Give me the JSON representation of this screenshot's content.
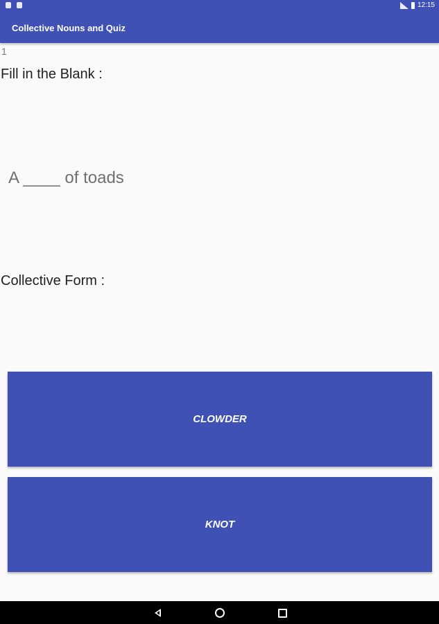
{
  "status_bar": {
    "time": "12:15",
    "icons": [
      "notification-icon",
      "notification-icon",
      "signal-icon",
      "battery-icon"
    ]
  },
  "app_bar": {
    "title": "Collective Nouns and Quiz"
  },
  "quiz": {
    "question_number": "1",
    "fill_label": "Fill in the Blank :",
    "question_text": "A ____ of toads",
    "collective_label": "Collective Form :",
    "answers": [
      {
        "label": "CLOWDER"
      },
      {
        "label": "KNOT"
      }
    ]
  },
  "nav_bar": {
    "icons": [
      "back-icon",
      "home-icon",
      "recent-apps-icon"
    ]
  },
  "colors": {
    "primary": "#3f51b5",
    "background": "#fafafa",
    "nav_bar": "#000000"
  }
}
